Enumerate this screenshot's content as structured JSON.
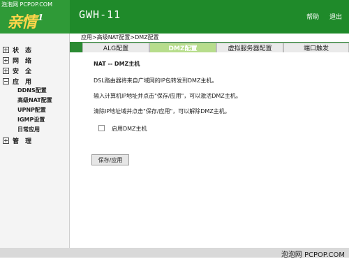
{
  "header": {
    "watermark": "泡泡网 PCPOP.COM",
    "logo_text": "亲情",
    "logo_mini": "1",
    "model": "GWH-11",
    "help_label": "帮助",
    "logout_label": "退出"
  },
  "sidebar": {
    "items": [
      {
        "label": "状　态",
        "expanded": false
      },
      {
        "label": "网　络",
        "expanded": false
      },
      {
        "label": "安　全",
        "expanded": false
      },
      {
        "label": "应　用",
        "expanded": true
      },
      {
        "label": "管　理",
        "expanded": false
      }
    ],
    "sub_items": [
      "DDNS配置",
      "高级NAT配置",
      "UPNP配置",
      "IGMP设置",
      "日常应用"
    ]
  },
  "breadcrumb": "应用>高级NAT配置>DMZ配置",
  "tabs": [
    {
      "label": "ALG配置",
      "active": false
    },
    {
      "label": "DMZ配置",
      "active": true
    },
    {
      "label": "虚拟服务器配置",
      "active": false
    },
    {
      "label": "端口触发",
      "active": false
    }
  ],
  "content": {
    "title": "NAT -- DMZ主机",
    "desc1": "DSL路由器将来自广域网的IP包转发到DMZ主机。",
    "desc2": "输入计算机IP地址并点击\"保存/应用\"，可以激活DMZ主机。",
    "desc3": "清除IP地址域并点击\"保存/应用\"，可以解除DMZ主机。",
    "enable_label": "启用DMZ主机",
    "enable_checked": false,
    "save_label": "保存/应用"
  },
  "footer": {
    "watermark": "泡泡网 PCPOP.COM"
  },
  "colors": {
    "header_green": "#1f8a2a",
    "tab_active": "#b7dd8c",
    "logo_yellow": "#ffd54a"
  }
}
